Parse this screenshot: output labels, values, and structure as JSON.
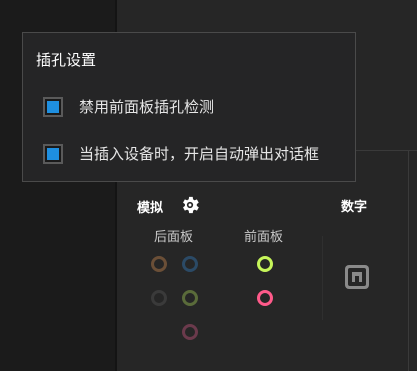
{
  "dialog": {
    "title": "插孔设置",
    "options": [
      {
        "label": "禁用前面板插孔检测",
        "checked": true
      },
      {
        "label": "当插入设备时，开启自动弹出对话框",
        "checked": true
      }
    ]
  },
  "panel": {
    "analog_label": "模拟",
    "digital_label": "数字",
    "rear_label": "后面板",
    "front_label": "前面板",
    "rear_jacks": [
      {
        "name": "brown",
        "color": "#6b4f37"
      },
      {
        "name": "blue",
        "color": "#2b4a66"
      },
      {
        "name": "black",
        "color": "#3a3a3a"
      },
      {
        "name": "green",
        "color": "#5a6b3a"
      },
      {
        "name": "pink",
        "color": "#6b3a4c"
      }
    ],
    "front_jacks": [
      {
        "name": "lime",
        "color": "#c6f55a"
      },
      {
        "name": "pink",
        "color": "#ff5a8a"
      }
    ]
  },
  "icons": {
    "gear": "gear-icon",
    "digital_port": "optical-port-icon"
  },
  "colors": {
    "checkbox_fill": "#1e8fe0"
  }
}
